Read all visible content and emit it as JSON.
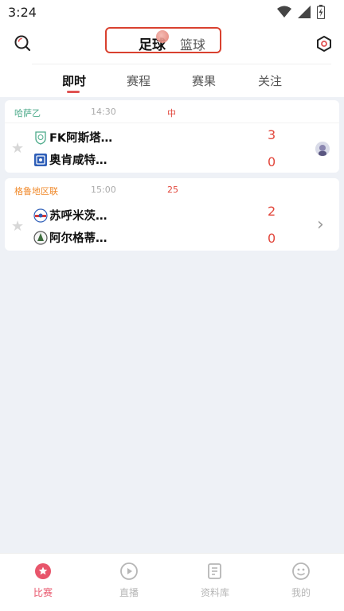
{
  "status_bar": {
    "time": "3:24"
  },
  "header": {
    "sport_tabs": [
      {
        "label": "足球",
        "active": true
      },
      {
        "label": "篮球",
        "active": false
      }
    ],
    "accent_color": "#d9412f"
  },
  "tabs": [
    {
      "label": "即时",
      "active": true
    },
    {
      "label": "赛程",
      "active": false
    },
    {
      "label": "赛果",
      "active": false
    },
    {
      "label": "关注",
      "active": false
    }
  ],
  "matches": [
    {
      "league": "哈萨乙",
      "league_color": "#4caa8a",
      "time": "14:30",
      "status": "中",
      "home": {
        "name": "FK阿斯塔…",
        "score": "3"
      },
      "away": {
        "name": "奥肯咸特…",
        "score": "0"
      },
      "side_icon": "avatar-icon"
    },
    {
      "league": "格鲁地区联",
      "league_color": "#f08a2c",
      "time": "15:00",
      "status": "25",
      "home": {
        "name": "苏呼米茨…",
        "score": "2"
      },
      "away": {
        "name": "阿尔格蒂…",
        "score": "0"
      },
      "side_icon": "chevron-right-icon"
    }
  ],
  "bottom_nav": [
    {
      "label": "比赛",
      "active": true,
      "icon": "trophy-icon"
    },
    {
      "label": "直播",
      "active": false,
      "icon": "play-icon"
    },
    {
      "label": "资料库",
      "active": false,
      "icon": "document-icon"
    },
    {
      "label": "我的",
      "active": false,
      "icon": "smiley-icon"
    }
  ]
}
